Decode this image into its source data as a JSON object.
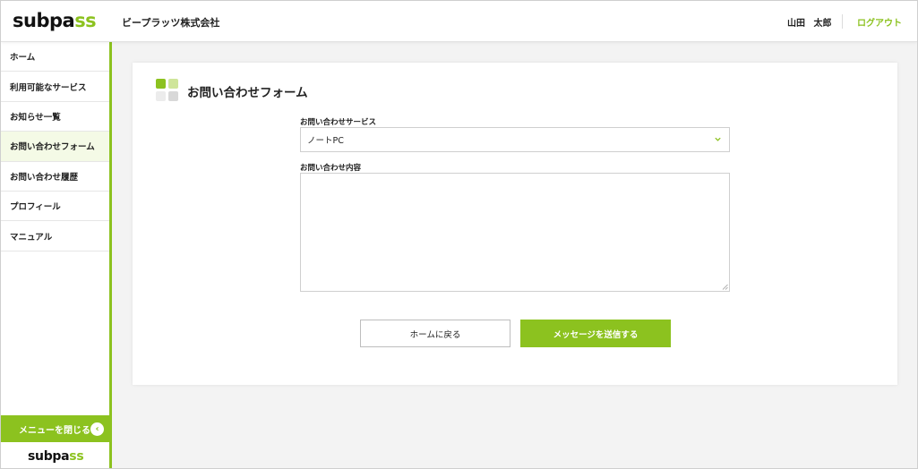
{
  "brand": {
    "logo_main": "subpa",
    "logo_accent": "ss",
    "accent_color": "#8cc21f"
  },
  "header": {
    "company": "ビープラッツ株式会社",
    "user_name": "山田 太郎",
    "logout_label": "ログアウト"
  },
  "sidebar": {
    "items": [
      {
        "label": "ホーム",
        "active": false
      },
      {
        "label": "利用可能なサービス",
        "active": false
      },
      {
        "label": "お知らせ一覧",
        "active": false
      },
      {
        "label": "お問い合わせフォーム",
        "active": true
      },
      {
        "label": "お問い合わせ履歴",
        "active": false
      },
      {
        "label": "プロフィール",
        "active": false
      },
      {
        "label": "マニュアル",
        "active": false
      }
    ],
    "close_menu_label": "メニューを閉じる",
    "close_menu_icon": "chevron-left-icon"
  },
  "form": {
    "title": "お問い合わせフォーム",
    "service_label": "お問い合わせサービス",
    "service_selected": "ノートPC",
    "content_label": "お問い合わせ内容",
    "content_value": "",
    "back_button": "ホームに戻る",
    "submit_button": "メッセージを送信する"
  }
}
